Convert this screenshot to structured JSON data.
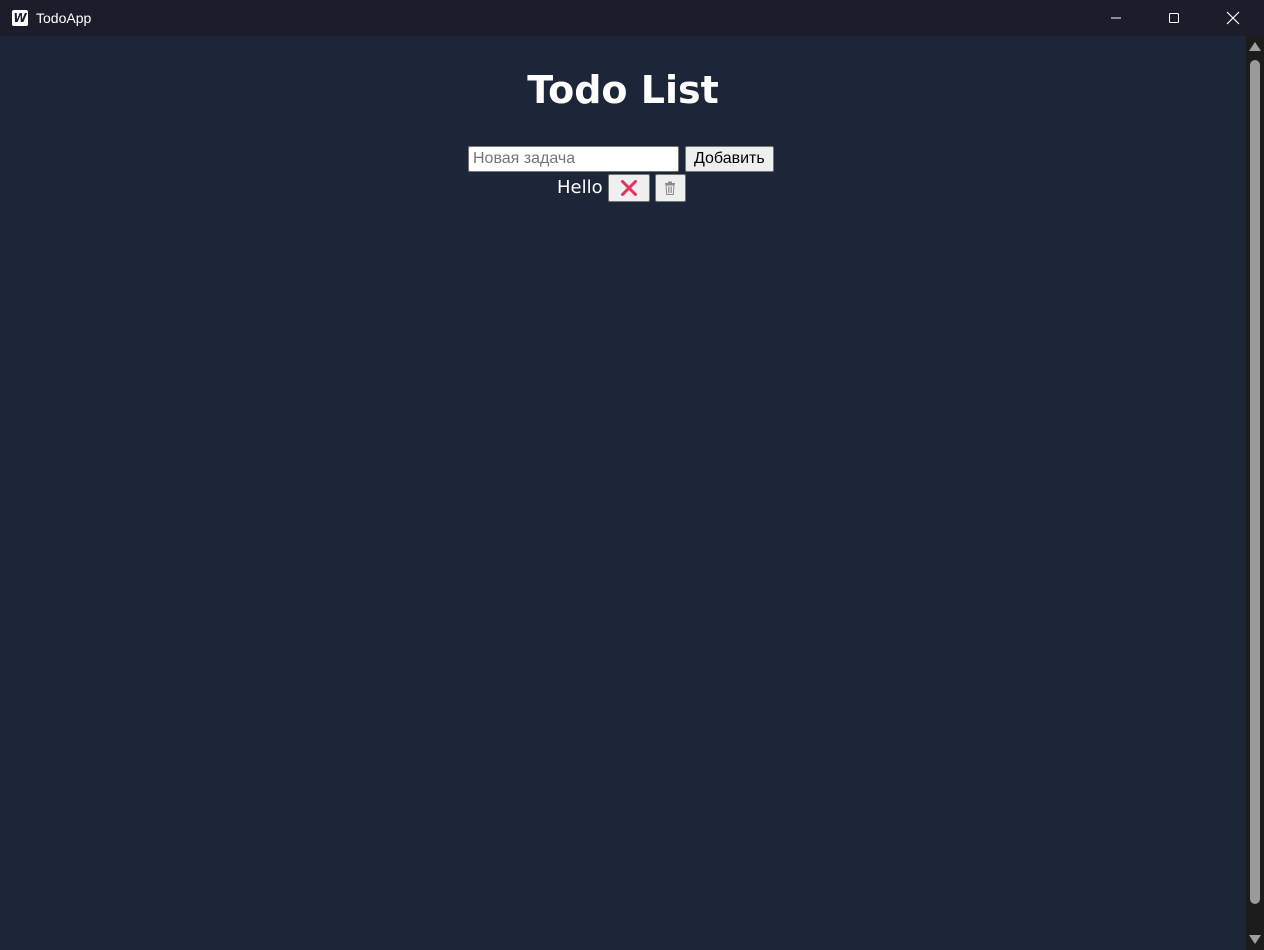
{
  "window": {
    "title": "TodoApp",
    "logo_letter": "W"
  },
  "page": {
    "title": "Todo List"
  },
  "add_form": {
    "input_value": "",
    "input_placeholder": "Новая задача",
    "add_button_label": "Добавить"
  },
  "todos": [
    {
      "text": "Hello",
      "toggle_icon": "red-x-icon",
      "delete_icon": "trash-icon"
    }
  ],
  "colors": {
    "background": "#1c2638",
    "titlebar": "#1b1e2a",
    "toggle_icon": "#e8305a"
  }
}
